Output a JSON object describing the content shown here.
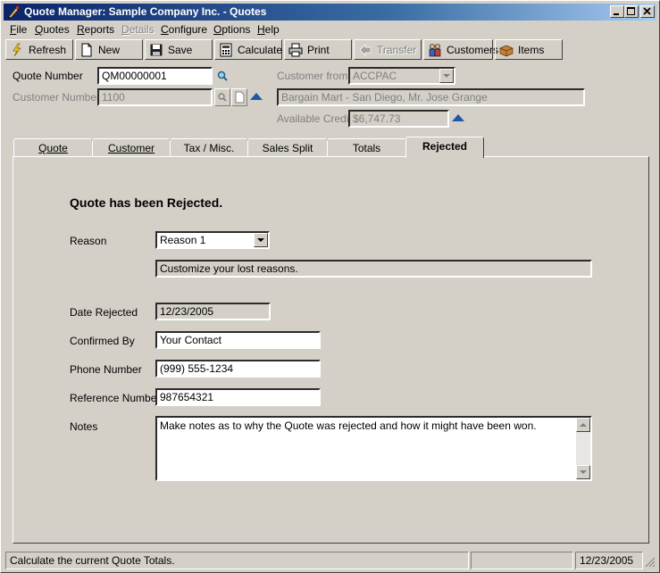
{
  "window": {
    "title": "Quote Manager: Sample Company Inc. - Quotes"
  },
  "menu": [
    {
      "label": "File",
      "ul": "F",
      "rest": "ile"
    },
    {
      "label": "Quotes",
      "ul": "Q",
      "rest": "uotes"
    },
    {
      "label": "Reports",
      "ul": "R",
      "rest": "eports"
    },
    {
      "label": "Details",
      "ul": "D",
      "rest": "etails"
    },
    {
      "label": "Configure",
      "ul": "C",
      "rest": "onfigure"
    },
    {
      "label": "Options",
      "ul": "O",
      "rest": "ptions"
    },
    {
      "label": "Help",
      "ul": "H",
      "rest": "elp"
    }
  ],
  "toolbar": {
    "refresh": "Refresh",
    "new": "New",
    "save": "Save",
    "calculate": "Calculate",
    "print": "Print",
    "transfer": "Transfer",
    "customers": "Customers",
    "items": "Items"
  },
  "header": {
    "quote_number_label": "Quote Number",
    "quote_number_value": "QM00000001",
    "customer_number_label": "Customer Number",
    "customer_number_value": "1100",
    "customer_from_label": "Customer from",
    "customer_from_value": "ACCPAC",
    "customer_name_value": "Bargain Mart - San Diego, Mr. Jose Grange",
    "available_credit_label": "Available Credit",
    "available_credit_value": "$6,747.73"
  },
  "tabs": [
    {
      "label": "Quote"
    },
    {
      "label": "Customer"
    },
    {
      "label": "Tax / Misc."
    },
    {
      "label": "Sales Split"
    },
    {
      "label": "Totals"
    },
    {
      "label": "Rejected"
    }
  ],
  "rejected": {
    "heading": "Quote has been Rejected.",
    "reason_label": "Reason",
    "reason_value": "Reason 1",
    "reason_desc": "Customize your lost reasons.",
    "date_label": "Date Rejected",
    "date_value": "12/23/2005",
    "confirmed_label": "Confirmed By",
    "confirmed_value": "Your Contact",
    "phone_label": "Phone Number",
    "phone_value": "(999) 555-1234",
    "reference_label": "Reference Number",
    "reference_value": "987654321",
    "notes_label": "Notes",
    "notes_value": "Make notes as to why the Quote was rejected and how it might have been won."
  },
  "status": {
    "message": "Calculate the current Quote Totals.",
    "date": "12/23/2005"
  },
  "colors": {
    "title_bar": "#0a246a",
    "face": "#d4d0c8",
    "accent_arrow": "#1d5aa6"
  }
}
